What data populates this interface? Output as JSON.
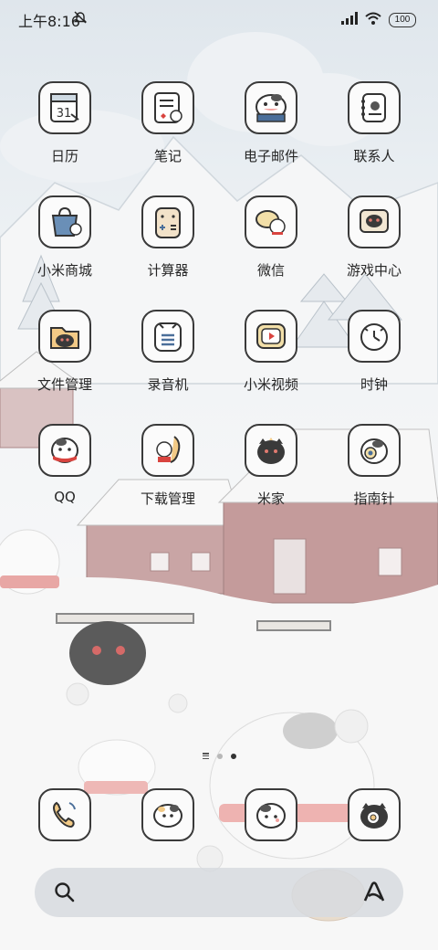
{
  "status_bar": {
    "time": "上午8:16",
    "battery": "100",
    "icons": [
      "do-not-disturb-icon",
      "signal-icon",
      "wifi-icon",
      "battery-icon"
    ]
  },
  "apps": [
    {
      "label": "日历",
      "icon": "calendar-icon",
      "day": "31"
    },
    {
      "label": "笔记",
      "icon": "notes-icon"
    },
    {
      "label": "电子邮件",
      "icon": "email-icon"
    },
    {
      "label": "联系人",
      "icon": "contacts-icon"
    },
    {
      "label": "小米商城",
      "icon": "mi-store-icon"
    },
    {
      "label": "计算器",
      "icon": "calculator-icon"
    },
    {
      "label": "微信",
      "icon": "wechat-icon"
    },
    {
      "label": "游戏中心",
      "icon": "game-center-icon"
    },
    {
      "label": "文件管理",
      "icon": "file-manager-icon"
    },
    {
      "label": "录音机",
      "icon": "recorder-icon"
    },
    {
      "label": "小米视频",
      "icon": "mi-video-icon"
    },
    {
      "label": "时钟",
      "icon": "clock-icon"
    },
    {
      "label": "QQ",
      "icon": "qq-icon"
    },
    {
      "label": "下载管理",
      "icon": "downloads-icon"
    },
    {
      "label": "米家",
      "icon": "mi-home-icon"
    },
    {
      "label": "指南针",
      "icon": "compass-icon"
    }
  ],
  "page_indicator": {
    "pages": 2,
    "current": 2
  },
  "dock": [
    {
      "icon": "phone-icon"
    },
    {
      "icon": "messages-icon"
    },
    {
      "icon": "browser-icon"
    },
    {
      "icon": "camera-icon"
    }
  ],
  "search_bar": {
    "left_icon": "search-icon",
    "right_icon": "assistant-icon"
  },
  "colors": {
    "icon_border": "#3a3a3a",
    "label": "#262626",
    "red_accent": "#d9443f"
  }
}
